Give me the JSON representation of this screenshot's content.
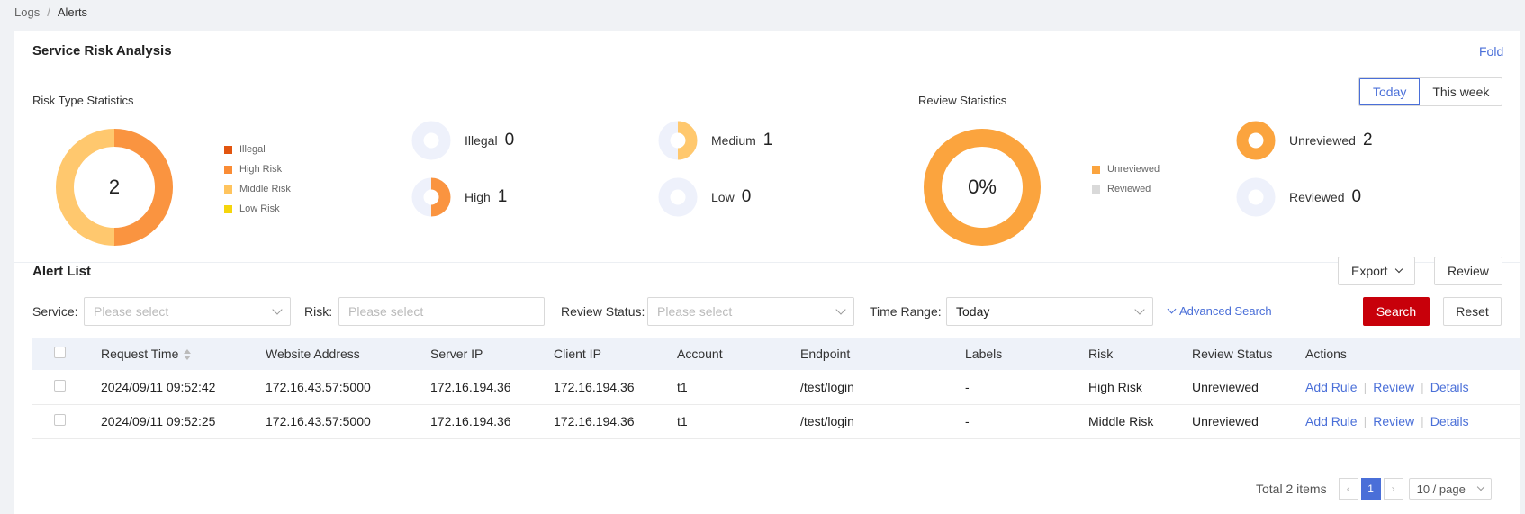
{
  "breadcrumb": {
    "parent": "Logs",
    "separator": "/",
    "current": "Alerts"
  },
  "risk_panel": {
    "title": "Service Risk Analysis",
    "fold_label": "Fold",
    "period_tabs": [
      "Today",
      "This week"
    ],
    "active_period": "Today",
    "risk_type": {
      "title": "Risk Type Statistics",
      "total": "2",
      "legend": [
        {
          "label": "Illegal",
          "color": "#e2550f"
        },
        {
          "label": "High Risk",
          "color": "#fa8c35"
        },
        {
          "label": "Middle Risk",
          "color": "#ffc45e"
        },
        {
          "label": "Low Risk",
          "color": "#f5d50c"
        }
      ],
      "donut": [
        {
          "name": "High Risk",
          "value": 1,
          "color": "#fa9440"
        },
        {
          "name": "Middle Risk",
          "value": 1,
          "color": "#ffc86e"
        }
      ],
      "stats": [
        {
          "label": "Illegal",
          "value": "0",
          "fraction": 0,
          "color": "#e2550f"
        },
        {
          "label": "Medium",
          "value": "1",
          "fraction": 0.5,
          "color": "#ffc86e"
        },
        {
          "label": "High",
          "value": "1",
          "fraction": 0.5,
          "color": "#fa9440"
        },
        {
          "label": "Low",
          "value": "0",
          "fraction": 0,
          "color": "#f5d50c"
        }
      ]
    },
    "review": {
      "title": "Review Statistics",
      "center": "0%",
      "legend": [
        {
          "label": "Unreviewed",
          "color": "#fba43e"
        },
        {
          "label": "Reviewed",
          "color": "#d9d9d9"
        }
      ],
      "donut": [
        {
          "name": "Unreviewed",
          "value": 2,
          "color": "#fba43e"
        }
      ],
      "stats": [
        {
          "label": "Unreviewed",
          "value": "2",
          "fraction": 1,
          "color": "#fba43e"
        },
        {
          "label": "Reviewed",
          "value": "0",
          "fraction": 0,
          "color": "#d9d9d9"
        }
      ]
    }
  },
  "alert_list": {
    "title": "Alert List",
    "export_label": "Export",
    "review_label": "Review",
    "filters": {
      "service_label": "Service:",
      "service_placeholder": "Please select",
      "risk_label": "Risk:",
      "risk_placeholder": "Please select",
      "review_status_label": "Review Status:",
      "review_status_placeholder": "Please select",
      "time_range_label": "Time Range:",
      "time_range_value": "Today",
      "advanced_search": "Advanced Search",
      "search_label": "Search",
      "reset_label": "Reset"
    },
    "columns": [
      "Request Time",
      "Website Address",
      "Server IP",
      "Client IP",
      "Account",
      "Endpoint",
      "Labels",
      "Risk",
      "Review Status",
      "Actions"
    ],
    "rows": [
      {
        "request_time": "2024/09/11 09:52:42",
        "website": "172.16.43.57:5000",
        "server_ip": "172.16.194.36",
        "client_ip": "172.16.194.36",
        "account": "t1",
        "endpoint": "/test/login",
        "labels": "-",
        "risk": "High Risk",
        "review_status": "Unreviewed"
      },
      {
        "request_time": "2024/09/11 09:52:25",
        "website": "172.16.43.57:5000",
        "server_ip": "172.16.194.36",
        "client_ip": "172.16.194.36",
        "account": "t1",
        "endpoint": "/test/login",
        "labels": "-",
        "risk": "Middle Risk",
        "review_status": "Unreviewed"
      }
    ],
    "actions": [
      "Add Rule",
      "Review",
      "Details"
    ],
    "pagination": {
      "total_text": "Total 2 items",
      "current_page": "1",
      "page_size": "10 / page"
    }
  }
}
